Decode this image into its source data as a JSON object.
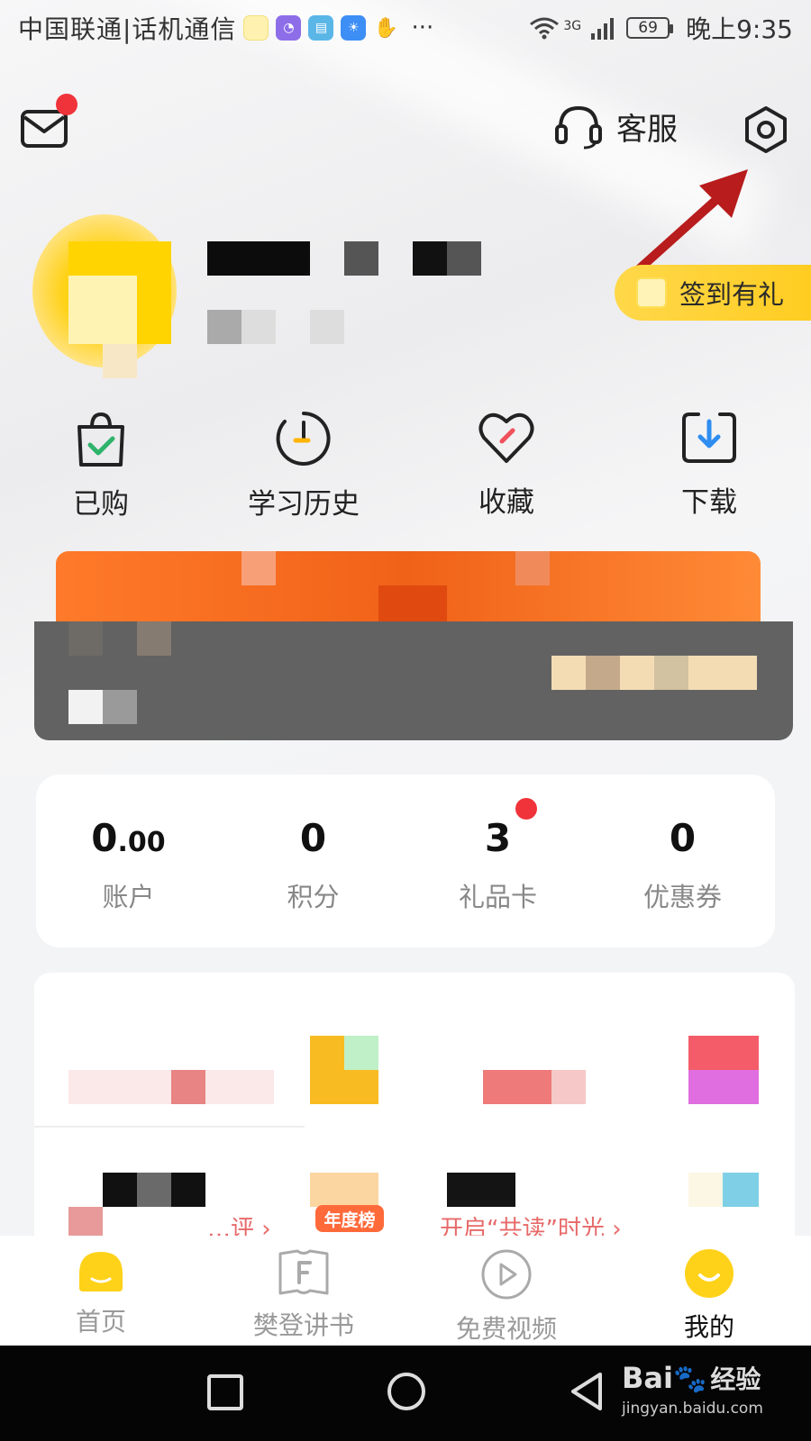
{
  "status_bar": {
    "carrier": "中国联通|话机通信",
    "more": "···",
    "network": "3G",
    "battery": "69",
    "time": "晚上9:35"
  },
  "header": {
    "service_label": "客服"
  },
  "checkin": {
    "label": "签到有礼"
  },
  "quick_actions": [
    {
      "label": "已购",
      "icon": "shopping-bag-check-icon"
    },
    {
      "label": "学习历史",
      "icon": "history-clock-icon"
    },
    {
      "label": "收藏",
      "icon": "heart-icon"
    },
    {
      "label": "下载",
      "icon": "download-icon"
    }
  ],
  "stats": [
    {
      "value_main": "0",
      "value_decimal": ".00",
      "label": "账户"
    },
    {
      "value_main": "0",
      "value_decimal": "",
      "label": "积分"
    },
    {
      "value_main": "3",
      "value_decimal": "",
      "label": "礼品卡"
    },
    {
      "value_main": "0",
      "value_decimal": "",
      "label": "优惠券"
    }
  ],
  "lower_panel": {
    "left_link": "…评 ›",
    "badge": "年度榜",
    "right_link": "开启“共读”时光 ›"
  },
  "bottom_nav": [
    {
      "label": "首页",
      "active": false
    },
    {
      "label": "樊登讲书",
      "active": false
    },
    {
      "label": "免费视频",
      "active": false
    },
    {
      "label": "我的",
      "active": true
    }
  ],
  "watermark": {
    "brand": "Bai",
    "cn": "经验",
    "url": "jingyan.baidu.com"
  },
  "colors": {
    "accent_yellow": "#ffcc1f",
    "notify_red": "#f0333a",
    "vip_orange": "#f06218",
    "arrow_red": "#b81c1c"
  }
}
